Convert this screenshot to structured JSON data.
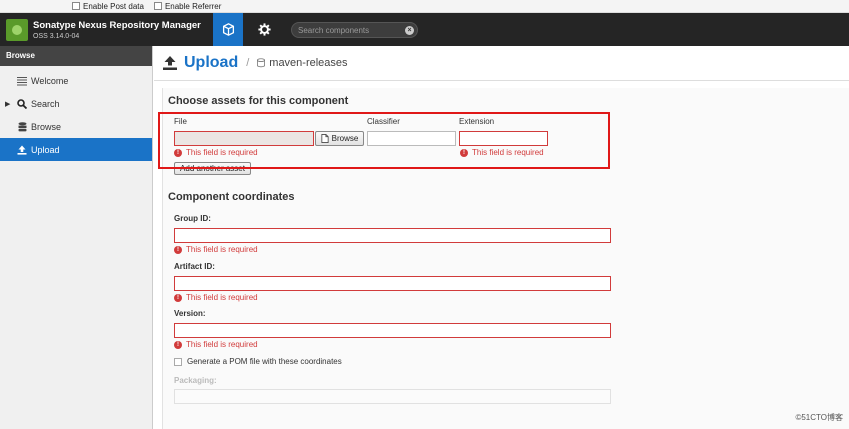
{
  "addon_bar": {
    "options": [
      {
        "label": "Enable Post data"
      },
      {
        "label": "Enable Referrer"
      }
    ]
  },
  "header": {
    "app_name": "Sonatype Nexus Repository Manager",
    "version": "OSS 3.14.0-04",
    "browse_icon": "cube-icon",
    "admin_icon": "gear-icon",
    "search_placeholder": "Search components"
  },
  "sidebar": {
    "title": "Browse",
    "items": [
      {
        "label": "Welcome",
        "icon": "list-icon"
      },
      {
        "label": "Search",
        "icon": "search-icon"
      },
      {
        "label": "Browse",
        "icon": "database-icon"
      },
      {
        "label": "Upload",
        "icon": "upload-icon",
        "active": true
      }
    ]
  },
  "page": {
    "title": "Upload",
    "separator": "/",
    "repository": "maven-releases"
  },
  "assets": {
    "heading": "Choose assets for this component",
    "file_label": "File",
    "classifier_label": "Classifier",
    "extension_label": "Extension",
    "browse_label": "Browse",
    "error": "This field is required",
    "add_asset_label": "Add another asset"
  },
  "coordinates": {
    "heading": "Component coordinates",
    "group_label": "Group ID:",
    "artifact_label": "Artifact ID:",
    "version_label": "Version:",
    "error": "This field is required",
    "pom_label": "Generate a POM file with these coordinates",
    "packaging_label": "Packaging:"
  },
  "watermark": "©51CTO博客",
  "colors": {
    "accent": "#1a73c7",
    "error": "#d13b3b",
    "annotation": "#e01818"
  }
}
